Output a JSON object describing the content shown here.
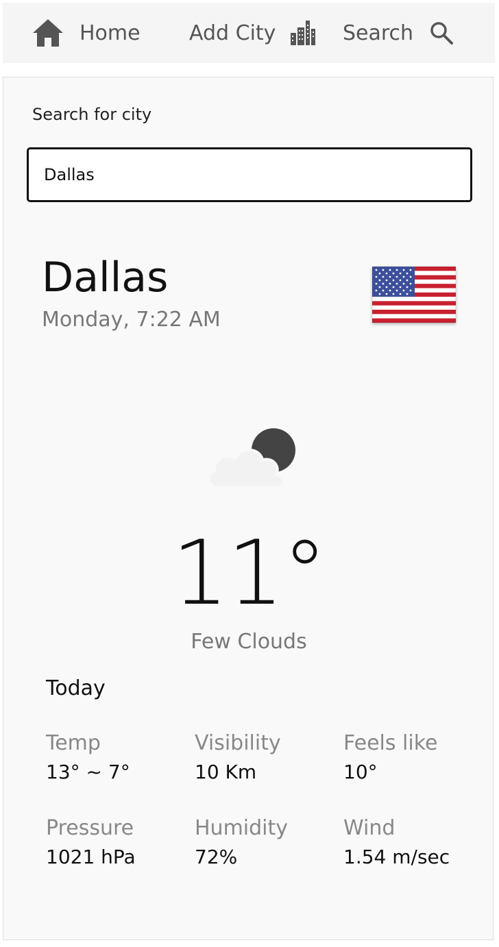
{
  "nav": {
    "home": {
      "label": "Home",
      "icon": "home-icon"
    },
    "add_city": {
      "label": "Add City",
      "icon": "city-buildings-icon"
    },
    "search": {
      "label": "Search",
      "icon": "search-icon"
    }
  },
  "search": {
    "label": "Search for city",
    "value": "Dallas"
  },
  "weather": {
    "city": "Dallas",
    "datetime": "Monday, 7:22 AM",
    "country_flag": "us-flag-icon",
    "condition_icon": "cloud-night-icon",
    "temperature": "11°",
    "condition": "Few Clouds"
  },
  "today": {
    "title": "Today",
    "stats": [
      {
        "label": "Temp",
        "value": "13° ~ 7°"
      },
      {
        "label": "Visibility",
        "value": "10 Km"
      },
      {
        "label": "Feels like",
        "value": "10°"
      },
      {
        "label": "Pressure",
        "value": "1021 hPa"
      },
      {
        "label": "Humidity",
        "value": "72%"
      },
      {
        "label": "Wind",
        "value": "1.54 m/sec"
      }
    ]
  },
  "colors": {
    "nav_bg": "#f5f5f5",
    "card_bg": "#f9f9f9",
    "muted_text": "#777777"
  }
}
